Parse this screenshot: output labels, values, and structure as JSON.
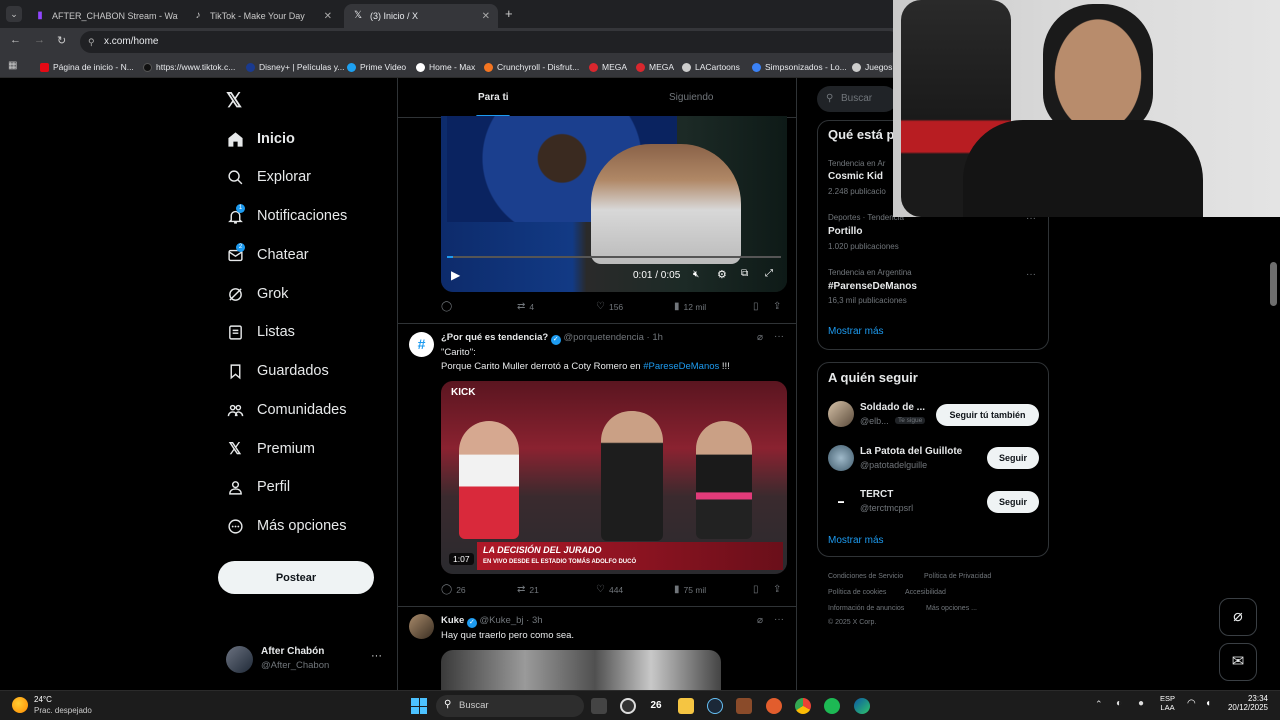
{
  "browser": {
    "tabs": [
      {
        "title": "AFTER_CHABON Stream - Watc",
        "favicon": "twitch-icon",
        "color": "#9146ff"
      },
      {
        "title": "TikTok - Make Your Day",
        "favicon": "tiktok-icon",
        "color": "#ffffff"
      },
      {
        "title": "(3) Inicio / X",
        "favicon": "x-icon",
        "color": "#ffffff"
      }
    ],
    "url": "x.com/home",
    "bookmarks": [
      {
        "label": "Página de inicio - N...",
        "color": "#e50914"
      },
      {
        "label": "https://www.tiktok.c...",
        "color": "#111111"
      },
      {
        "label": "Disney+ | Películas y...",
        "color": "#1a3a8f"
      },
      {
        "label": "Prime Video",
        "color": "#1da1f2"
      },
      {
        "label": "Home - Max",
        "color": "#ffffff"
      },
      {
        "label": "Crunchyroll - Disfrut...",
        "color": "#f47521"
      },
      {
        "label": "MEGA",
        "color": "#d9272e"
      },
      {
        "label": "MEGA",
        "color": "#d9272e"
      },
      {
        "label": "LACartoons",
        "color": "#cccccc"
      },
      {
        "label": "Simpsonizados - Lo...",
        "color": "#3b82f6"
      },
      {
        "label": "Juegos",
        "color": "#cccccc"
      }
    ]
  },
  "nav": {
    "items": [
      {
        "label": "Inicio",
        "icon": "home-icon"
      },
      {
        "label": "Explorar",
        "icon": "search-icon"
      },
      {
        "label": "Notificaciones",
        "icon": "bell-icon",
        "badge": "1"
      },
      {
        "label": "Chatear",
        "icon": "mail-icon",
        "badge": "2"
      },
      {
        "label": "Grok",
        "icon": "grok-icon"
      },
      {
        "label": "Listas",
        "icon": "list-icon"
      },
      {
        "label": "Guardados",
        "icon": "bookmark-icon"
      },
      {
        "label": "Comunidades",
        "icon": "communities-icon"
      },
      {
        "label": "Premium",
        "icon": "x-icon"
      },
      {
        "label": "Perfil",
        "icon": "person-icon"
      },
      {
        "label": "Más opciones",
        "icon": "more-circle-icon"
      }
    ],
    "post_label": "Postear",
    "account": {
      "name": "After Chabón",
      "handle": "@After_Chabon"
    }
  },
  "feed": {
    "tabs": [
      "Para ti",
      "Siguiendo"
    ],
    "video": {
      "time": "0:01 / 0:05"
    },
    "tweet1_actions": {
      "replies": "",
      "retweets": "4",
      "likes": "156",
      "views": "12 mil"
    },
    "tweet2": {
      "name": "¿Por qué es tendencia?",
      "handle": "@porquetendencia",
      "time": "1h",
      "line1": "\"Carito\":",
      "line2": "Porque Carito Muller derrotó a Coty Romero en",
      "hashtag": "#PareseDeManos",
      "suffix": " !!!",
      "video_duration": "1:07",
      "banner_title": "LA DECISIÓN DEL JURADO",
      "banner_sub": "EN VIVO DESDE EL ESTADIO TOMÁS ADOLFO DUCÓ",
      "kick": "KICK",
      "replies": "26",
      "retweets": "21",
      "likes": "444",
      "views": "75 mil"
    },
    "tweet3": {
      "name": "Kuke",
      "handle": "@Kuke_bj",
      "time": "3h",
      "text": "Hay que traerlo pero como sea."
    }
  },
  "sidebar": {
    "search_placeholder": "Buscar",
    "trends_title": "Qué está p",
    "trends": [
      {
        "meta": "Tendencia en Ar",
        "name": "Cosmic Kid",
        "count": "2.248 publicacio"
      },
      {
        "meta": "Deportes · Tendencia",
        "name": "Portillo",
        "count": "1.020 publicaciones"
      },
      {
        "meta": "Tendencia en Argentina",
        "name": "#ParenseDeManos",
        "count": "16,3 mil publicaciones"
      }
    ],
    "show_more": "Mostrar más",
    "follow_title": "A quién seguir",
    "follow": [
      {
        "name": "Soldado de ...",
        "handle": "@elb...",
        "follows_you": "Te sigue",
        "button": "Seguir tú también"
      },
      {
        "name": "La Patota del Guillote",
        "handle": "@patotadelguille",
        "button": "Seguir"
      },
      {
        "name": "TERCT",
        "handle": "@terctmcpsrl",
        "button": "Seguir"
      }
    ],
    "follow_more": "Mostrar más",
    "footer": [
      "Condiciones de Servicio",
      "Política de Privacidad",
      "Política de cookies",
      "Accesibilidad",
      "Información de anuncios",
      "Más opciones ...",
      "© 2025 X Corp."
    ]
  },
  "taskbar": {
    "weather_temp": "24°C",
    "weather_desc": "Prac. despejado",
    "search": "Buscar",
    "calendar_badge": "26",
    "lang1": "ESP",
    "lang2": "LAA",
    "time": "23:34",
    "date": "20/12/2025"
  }
}
